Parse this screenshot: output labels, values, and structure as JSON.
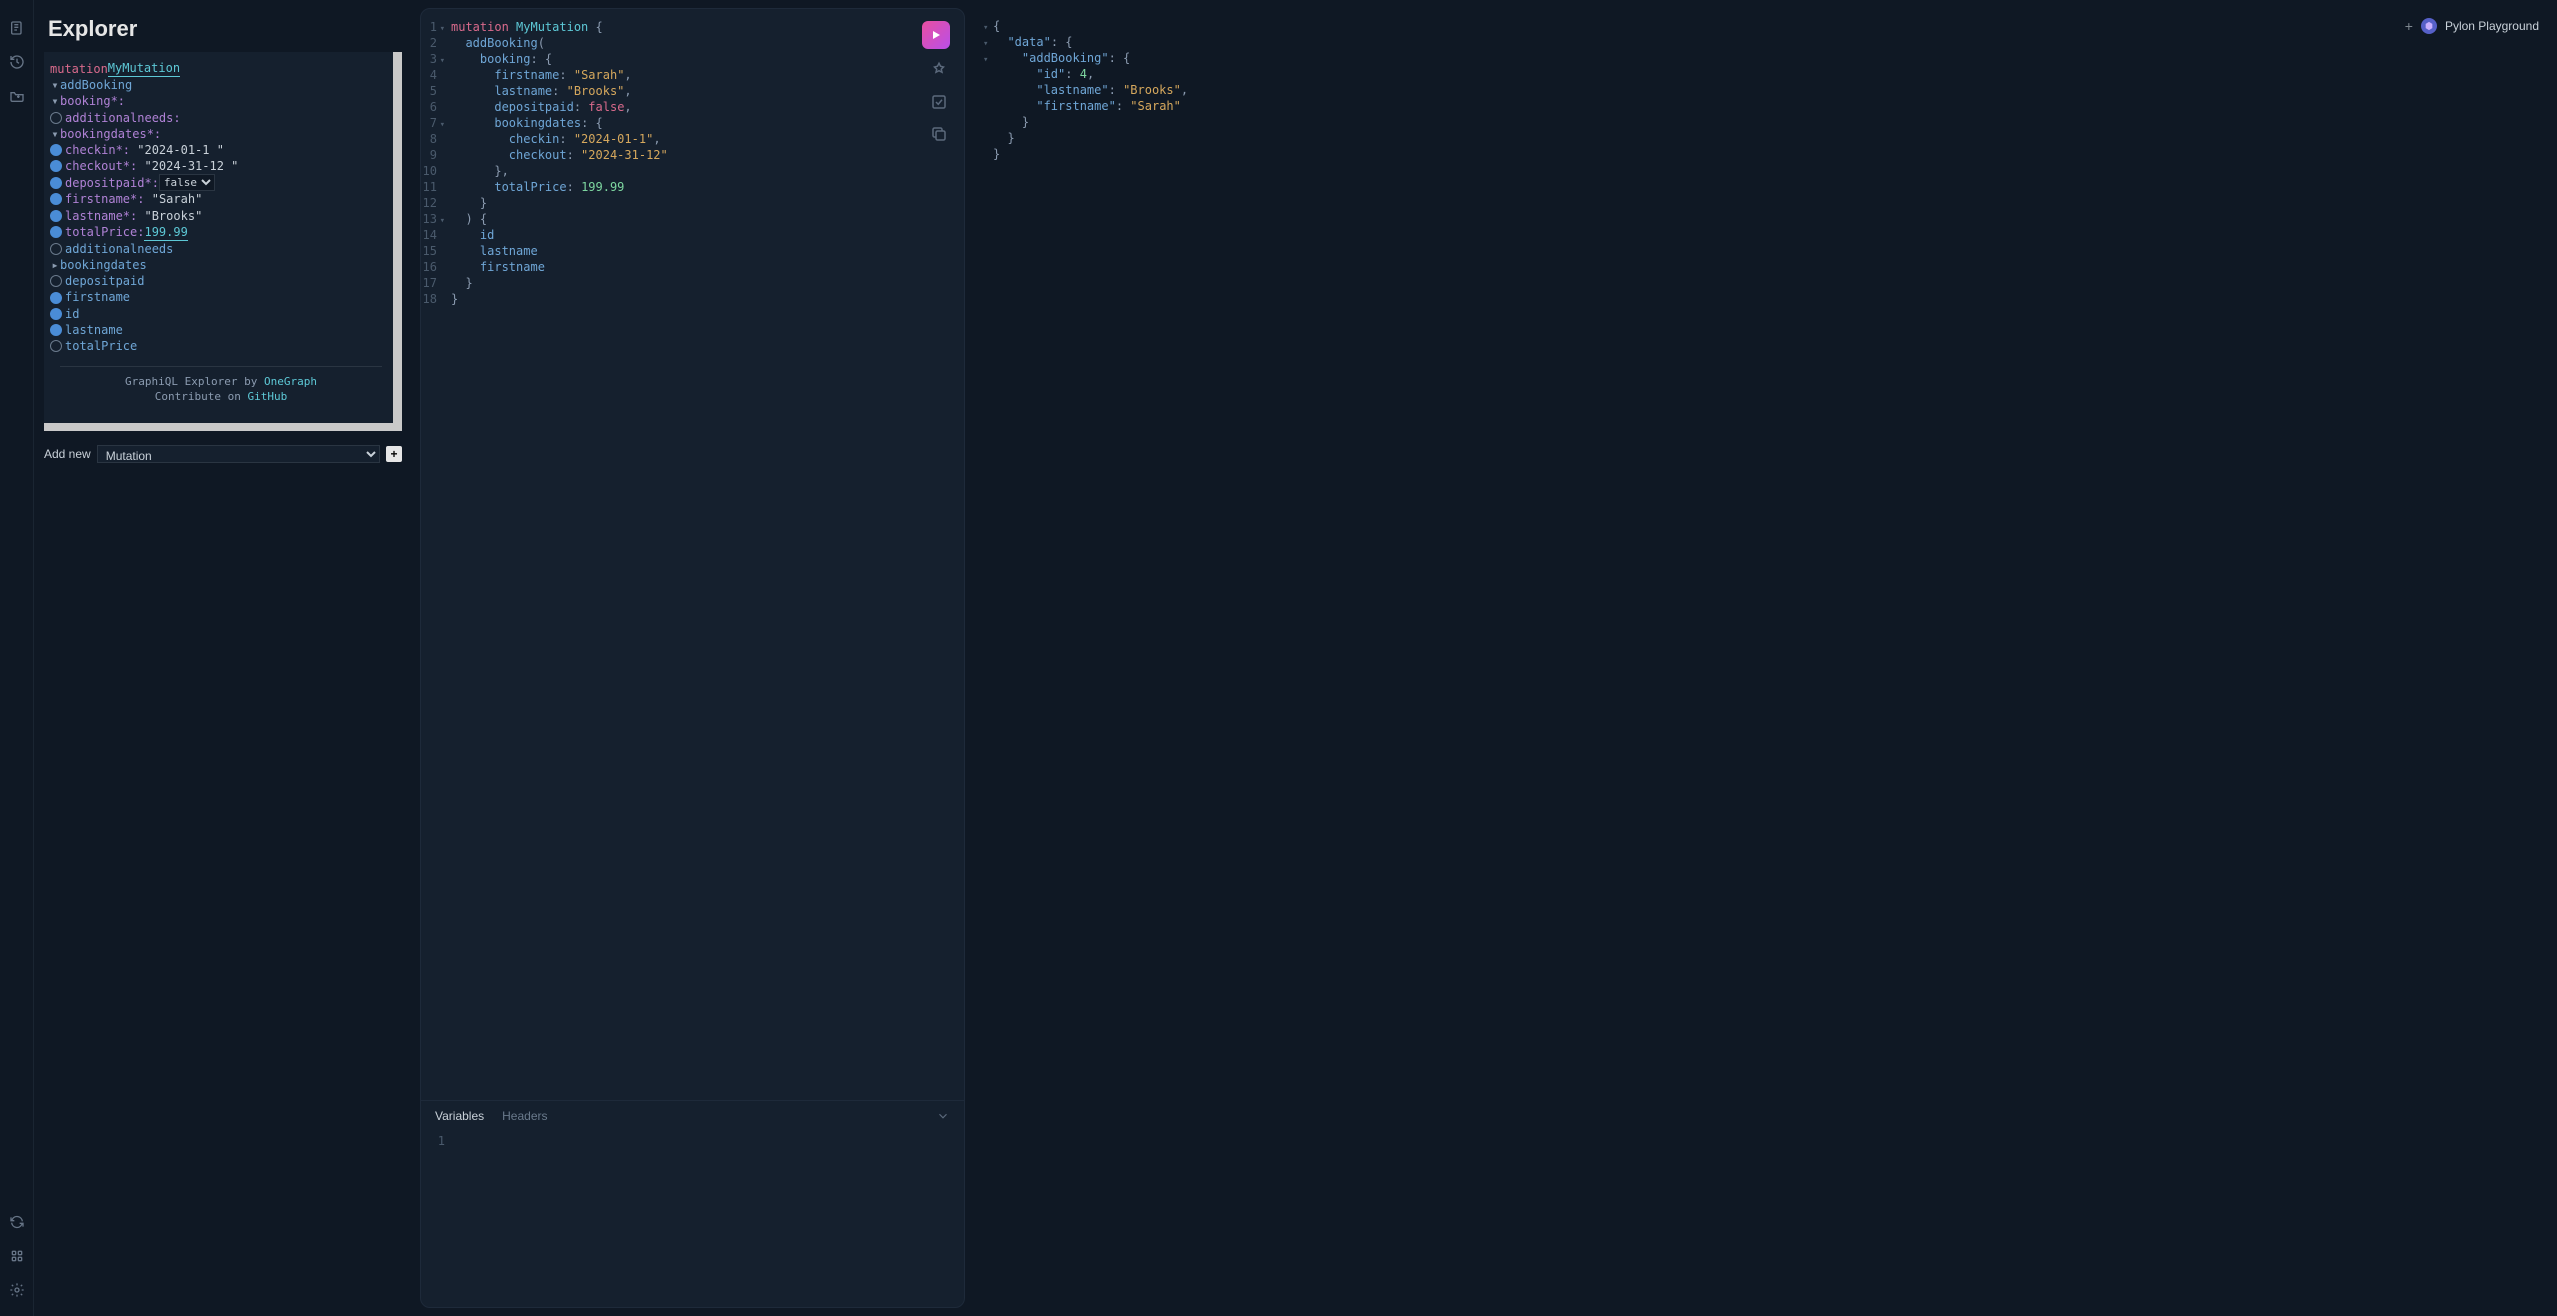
{
  "explorer": {
    "title": "Explorer",
    "operation_keyword": "mutation",
    "operation_name": "MyMutation",
    "tree": {
      "addBooking": {
        "label": "addBooking",
        "booking": {
          "label": "booking*:",
          "additionalneeds": {
            "label": "additionalneeds:"
          },
          "bookingdates": {
            "label": "bookingdates*:",
            "checkin": {
              "label": "checkin*:",
              "value": "2024-01-1"
            },
            "checkout": {
              "label": "checkout*:",
              "value": "2024-31-12"
            }
          },
          "depositpaid": {
            "label": "depositpaid*:",
            "value": "false"
          },
          "firstname": {
            "label": "firstname*:",
            "value": "Sarah"
          },
          "lastname": {
            "label": "lastname*:",
            "value": "Brooks"
          },
          "totalPrice": {
            "label": "totalPrice:",
            "value": "199.99"
          }
        },
        "fields": {
          "additionalneeds": "additionalneeds",
          "bookingdates": "bookingdates",
          "depositpaid": "depositpaid",
          "firstname": "firstname",
          "id": "id",
          "lastname": "lastname",
          "totalPrice": "totalPrice"
        }
      }
    },
    "footer_line1_prefix": "GraphiQL Explorer by ",
    "footer_line1_link": "OneGraph",
    "footer_line2_prefix": "Contribute on ",
    "footer_line2_link": "GitHub",
    "add_new_label": "Add new",
    "add_new_option": "Mutation"
  },
  "editor": {
    "lines": [
      {
        "n": 1,
        "fold": true,
        "tokens": [
          [
            "kw",
            "mutation"
          ],
          [
            "punc",
            " "
          ],
          [
            "def",
            "MyMutation"
          ],
          [
            "punc",
            " {"
          ]
        ]
      },
      {
        "n": 2,
        "tokens": [
          [
            "punc",
            "  "
          ],
          [
            "field",
            "addBooking"
          ],
          [
            "punc",
            "("
          ]
        ]
      },
      {
        "n": 3,
        "fold": true,
        "tokens": [
          [
            "punc",
            "    "
          ],
          [
            "attr",
            "booking"
          ],
          [
            "punc",
            ": {"
          ]
        ]
      },
      {
        "n": 4,
        "tokens": [
          [
            "punc",
            "      "
          ],
          [
            "attr",
            "firstname"
          ],
          [
            "punc",
            ": "
          ],
          [
            "str",
            "\"Sarah\""
          ],
          [
            "punc",
            ","
          ]
        ]
      },
      {
        "n": 5,
        "tokens": [
          [
            "punc",
            "      "
          ],
          [
            "attr",
            "lastname"
          ],
          [
            "punc",
            ": "
          ],
          [
            "str",
            "\"Brooks\""
          ],
          [
            "punc",
            ","
          ]
        ]
      },
      {
        "n": 6,
        "tokens": [
          [
            "punc",
            "      "
          ],
          [
            "attr",
            "depositpaid"
          ],
          [
            "punc",
            ": "
          ],
          [
            "bool",
            "false"
          ],
          [
            "punc",
            ","
          ]
        ]
      },
      {
        "n": 7,
        "fold": true,
        "tokens": [
          [
            "punc",
            "      "
          ],
          [
            "attr",
            "bookingdates"
          ],
          [
            "punc",
            ": {"
          ]
        ]
      },
      {
        "n": 8,
        "tokens": [
          [
            "punc",
            "        "
          ],
          [
            "attr",
            "checkin"
          ],
          [
            "punc",
            ": "
          ],
          [
            "str",
            "\"2024-01-1\""
          ],
          [
            "punc",
            ","
          ]
        ]
      },
      {
        "n": 9,
        "tokens": [
          [
            "punc",
            "        "
          ],
          [
            "attr",
            "checkout"
          ],
          [
            "punc",
            ": "
          ],
          [
            "str",
            "\"2024-31-12\""
          ]
        ]
      },
      {
        "n": 10,
        "tokens": [
          [
            "punc",
            "      },"
          ]
        ]
      },
      {
        "n": 11,
        "tokens": [
          [
            "punc",
            "      "
          ],
          [
            "attr",
            "totalPrice"
          ],
          [
            "punc",
            ": "
          ],
          [
            "num",
            "199.99"
          ]
        ]
      },
      {
        "n": 12,
        "tokens": [
          [
            "punc",
            "    }"
          ]
        ]
      },
      {
        "n": 13,
        "fold": true,
        "tokens": [
          [
            "punc",
            "  ) {"
          ]
        ]
      },
      {
        "n": 14,
        "tokens": [
          [
            "punc",
            "    "
          ],
          [
            "field",
            "id"
          ]
        ]
      },
      {
        "n": 15,
        "tokens": [
          [
            "punc",
            "    "
          ],
          [
            "field",
            "lastname"
          ]
        ]
      },
      {
        "n": 16,
        "tokens": [
          [
            "punc",
            "    "
          ],
          [
            "field",
            "firstname"
          ]
        ]
      },
      {
        "n": 17,
        "tokens": [
          [
            "punc",
            "  }"
          ]
        ]
      },
      {
        "n": 18,
        "tokens": [
          [
            "punc",
            "}"
          ]
        ]
      }
    ],
    "tabs": {
      "variables": "Variables",
      "headers": "Headers"
    },
    "var_line_num": "1"
  },
  "response": {
    "lines": [
      {
        "fold": true,
        "tokens": [
          [
            "punc",
            "{"
          ]
        ]
      },
      {
        "fold": true,
        "tokens": [
          [
            "punc",
            "  "
          ],
          [
            "key",
            "\"data\""
          ],
          [
            "punc",
            ": {"
          ]
        ]
      },
      {
        "fold": true,
        "tokens": [
          [
            "punc",
            "    "
          ],
          [
            "key",
            "\"addBooking\""
          ],
          [
            "punc",
            ": {"
          ]
        ]
      },
      {
        "tokens": [
          [
            "punc",
            "      "
          ],
          [
            "key",
            "\"id\""
          ],
          [
            "punc",
            ": "
          ],
          [
            "num",
            "4"
          ],
          [
            "punc",
            ","
          ]
        ]
      },
      {
        "tokens": [
          [
            "punc",
            "      "
          ],
          [
            "key",
            "\"lastname\""
          ],
          [
            "punc",
            ": "
          ],
          [
            "str",
            "\"Brooks\""
          ],
          [
            "punc",
            ","
          ]
        ]
      },
      {
        "tokens": [
          [
            "punc",
            "      "
          ],
          [
            "key",
            "\"firstname\""
          ],
          [
            "punc",
            ": "
          ],
          [
            "str",
            "\"Sarah\""
          ]
        ]
      },
      {
        "tokens": [
          [
            "punc",
            "    }"
          ]
        ]
      },
      {
        "tokens": [
          [
            "punc",
            "  }"
          ]
        ]
      },
      {
        "tokens": [
          [
            "punc",
            "}"
          ]
        ]
      }
    ],
    "brand": "Pylon Playground"
  }
}
